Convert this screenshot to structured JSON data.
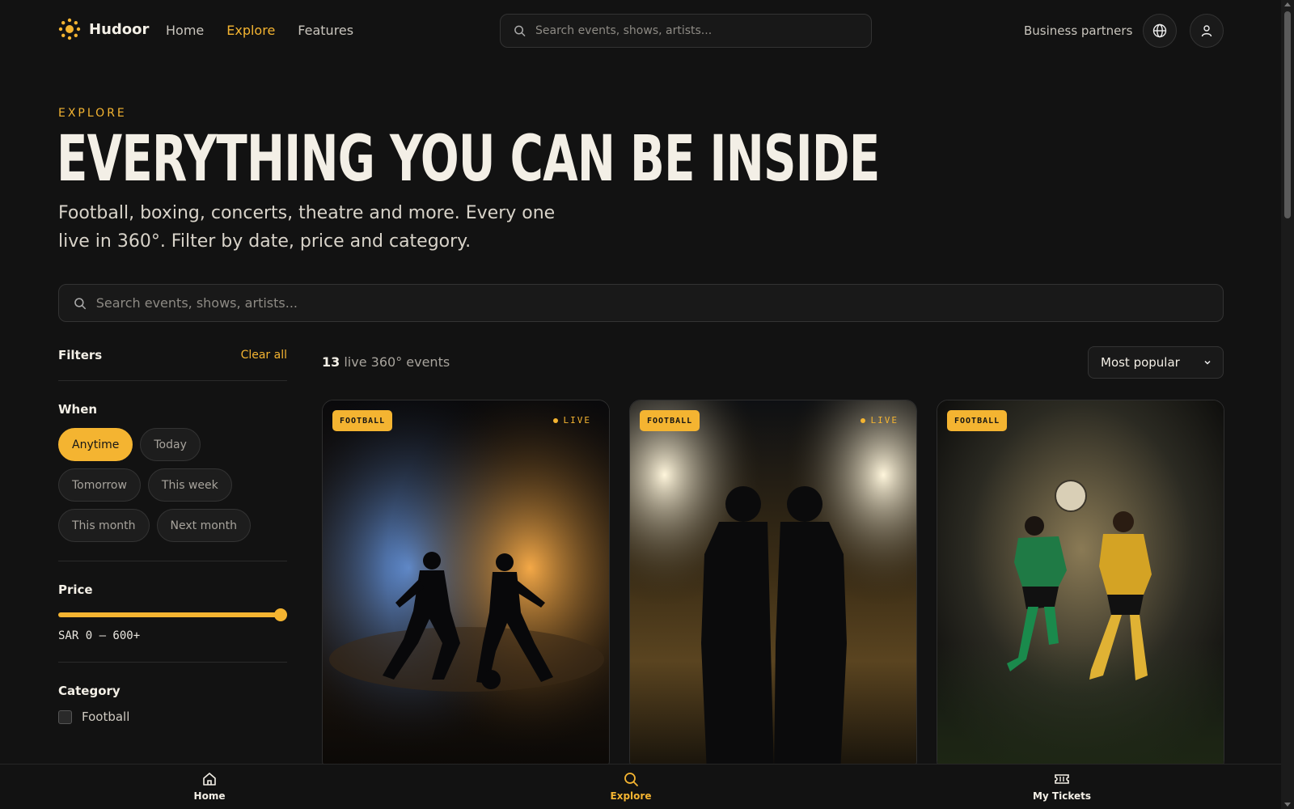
{
  "header": {
    "brand_name": "Hudoor",
    "nav": [
      {
        "label": "Home"
      },
      {
        "label": "Explore",
        "active": true
      },
      {
        "label": "Features"
      }
    ],
    "search_placeholder": "Search events, shows, artists...",
    "business_partners": "Business partners",
    "icons": [
      "logo-icon",
      "search-icon",
      "globe-icon",
      "user-icon"
    ]
  },
  "hero": {
    "eyebrow": "EXPLORE",
    "title": "EVERYTHING YOU CAN BE INSIDE",
    "subtitle": "Football, boxing, concerts, theatre and more. Every one live in 360°. Filter by date, price and category.",
    "search_placeholder": "Search events, shows, artists..."
  },
  "filters": {
    "title": "Filters",
    "clear_all": "Clear all",
    "when": {
      "title": "When",
      "options": [
        "Anytime",
        "Today",
        "Tomorrow",
        "This week",
        "This month",
        "Next month"
      ],
      "selected": "Anytime"
    },
    "price": {
      "title": "Price",
      "label": "SAR 0 — 600+",
      "min": 0,
      "max": 600,
      "selected_max_fraction": 1.0
    },
    "category": {
      "title": "Category",
      "options": [
        {
          "label": "Football",
          "checked": false
        }
      ]
    }
  },
  "results": {
    "count": "13",
    "count_suffix": "live 360° events",
    "sort_value": "Most popular"
  },
  "cards": [
    {
      "badge": "FOOTBALL",
      "live": "LIVE",
      "image": "two footballers silhouetted dueling for ball in stadium"
    },
    {
      "badge": "FOOTBALL",
      "live": "LIVE",
      "image": "two players back to back under stadium floodlights"
    },
    {
      "badge": "FOOTBALL",
      "live": null,
      "image": "green and yellow kit players challenging for ball in stadium"
    }
  ],
  "bottom_nav": [
    {
      "label": "Home",
      "icon": "home-icon"
    },
    {
      "label": "Explore",
      "icon": "search-icon",
      "active": true
    },
    {
      "label": "My Tickets",
      "icon": "ticket-icon"
    }
  ],
  "colors": {
    "background": "#121212",
    "accent": "#f4b431",
    "text": "#f3efe6",
    "muted": "#a7a39c"
  }
}
